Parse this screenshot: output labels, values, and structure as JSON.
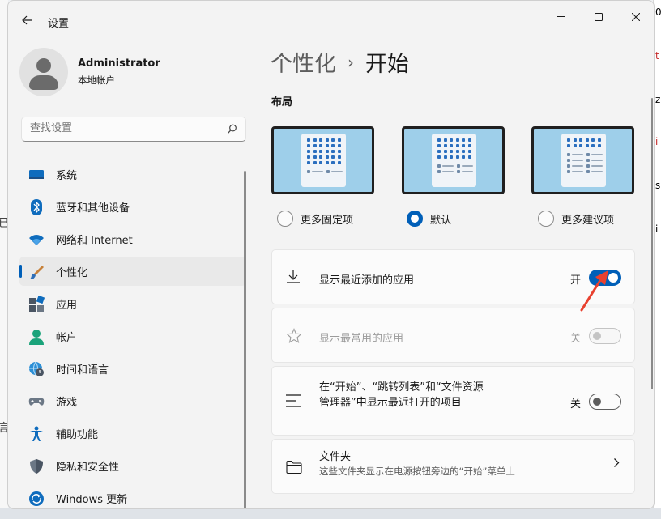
{
  "window": {
    "title": "设置",
    "back_label": "←"
  },
  "profile": {
    "name": "Administrator",
    "account_type": "本地帐户"
  },
  "search": {
    "placeholder": "查找设置"
  },
  "sidebar": {
    "items": [
      {
        "label": "系统",
        "icon": "system-icon"
      },
      {
        "label": "蓝牙和其他设备",
        "icon": "bluetooth-icon"
      },
      {
        "label": "网络和 Internet",
        "icon": "wifi-icon"
      },
      {
        "label": "个性化",
        "icon": "brush-icon",
        "active": true
      },
      {
        "label": "应用",
        "icon": "apps-icon"
      },
      {
        "label": "帐户",
        "icon": "account-icon"
      },
      {
        "label": "时间和语言",
        "icon": "globe-clock-icon"
      },
      {
        "label": "游戏",
        "icon": "gamepad-icon"
      },
      {
        "label": "辅助功能",
        "icon": "accessibility-icon"
      },
      {
        "label": "隐私和安全性",
        "icon": "shield-icon"
      },
      {
        "label": "Windows 更新",
        "icon": "update-icon"
      }
    ]
  },
  "main": {
    "breadcrumb_parent": "个性化",
    "breadcrumb_separator": "›",
    "breadcrumb_current": "开始",
    "layout_section_title": "布局",
    "layout_options": [
      {
        "label": "更多固定项",
        "selected": false
      },
      {
        "label": "默认",
        "selected": true
      },
      {
        "label": "更多建议项",
        "selected": false
      }
    ],
    "settings": {
      "recent_apps": {
        "label": "显示最近添加的应用",
        "state_label": "开",
        "on": true
      },
      "most_used": {
        "label": "显示最常用的应用",
        "state_label": "关",
        "on": false,
        "disabled": true
      },
      "recent_items": {
        "label": "在“开始”、“跳转列表”和“文件资源管理器”中显示最近打开的项目",
        "state_label": "关",
        "on": false
      },
      "folders": {
        "title": "文件夹",
        "subtitle": "这些文件夹显示在电源按钮旁边的“开始”菜单上"
      }
    }
  },
  "colors": {
    "accent": "#005fb8",
    "annotation": "#e8412f"
  }
}
